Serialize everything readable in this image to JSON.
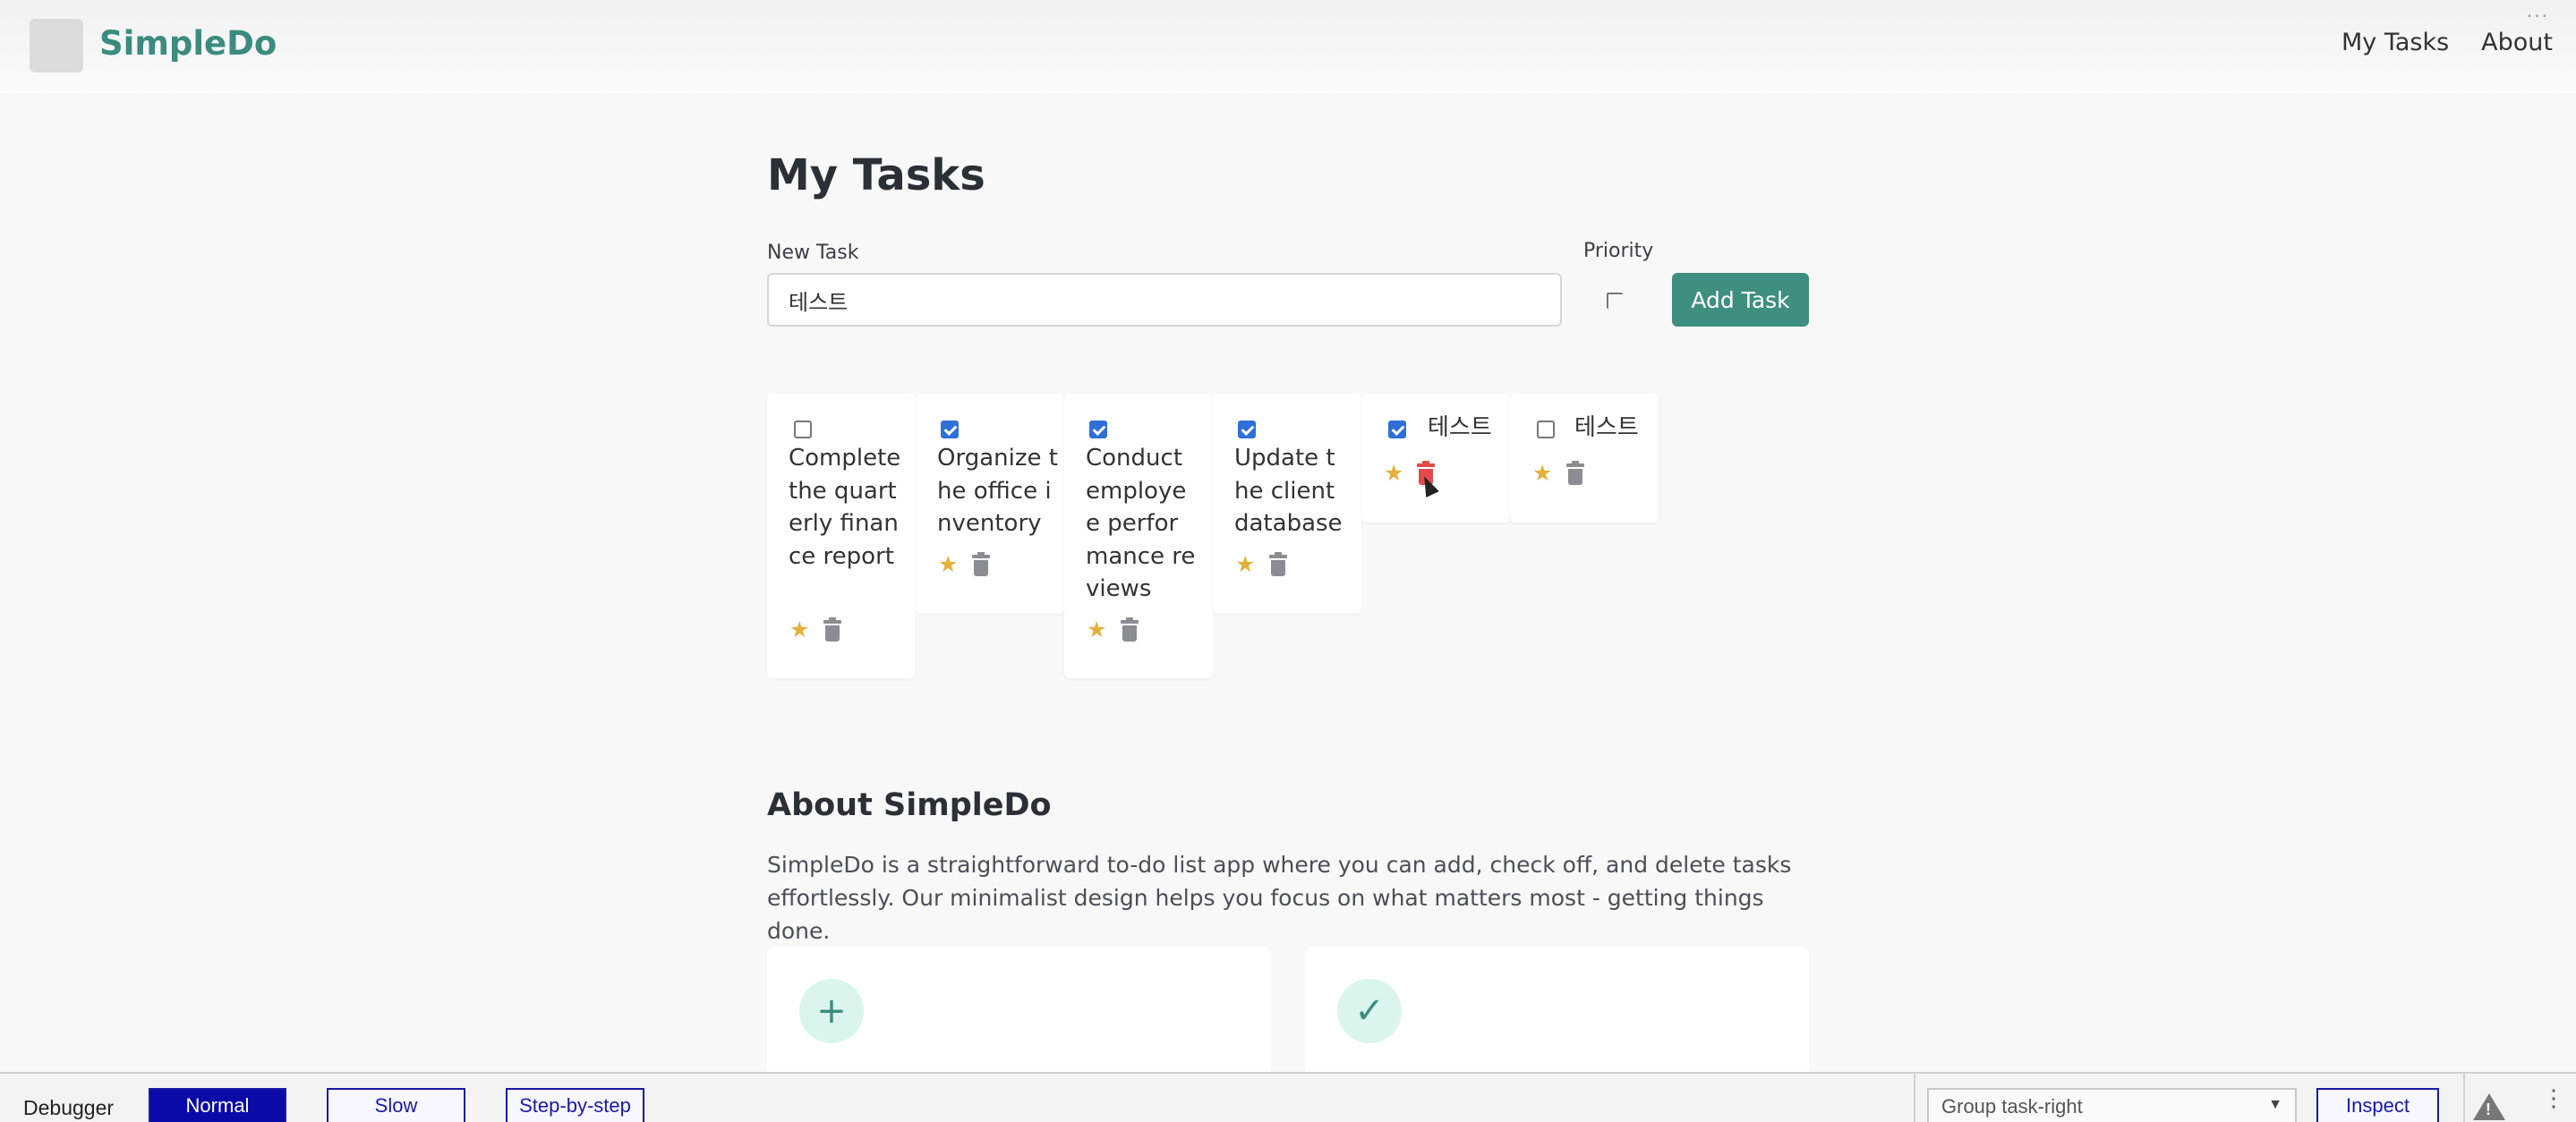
{
  "header": {
    "brand": "SimpleDo",
    "nav": [
      "My Tasks",
      "About"
    ]
  },
  "main": {
    "title": "My Tasks",
    "new_task_label": "New Task",
    "new_task_value": "테스트",
    "priority_label": "Priority",
    "priority_checked": false,
    "add_button": "Add Task",
    "tasks": [
      {
        "text": "Complete the quarterly finance report",
        "done": false
      },
      {
        "text": "Organize the office inventory",
        "done": true
      },
      {
        "text": "Conduct employee performance reviews",
        "done": true
      },
      {
        "text": "Update the client database",
        "done": true
      },
      {
        "text": "테스트",
        "done": true
      },
      {
        "text": "테스트",
        "done": false
      }
    ]
  },
  "about": {
    "title": "About SimpleDo",
    "text": "SimpleDo is a straightforward to-do list app where you can add, check off, and delete tasks effortlessly. Our minimalist design helps you focus on what matters most - getting things done.",
    "features": [
      {
        "icon": "plus-icon"
      },
      {
        "icon": "check-icon"
      }
    ]
  },
  "debugger": {
    "label": "Debugger",
    "modes": [
      "Normal",
      "Slow",
      "Step-by-step"
    ],
    "active_mode": "Normal",
    "group_select": "Group task-right",
    "inspect": "Inspect"
  },
  "colors": {
    "brand": "#3b8c7f",
    "accent_button": "#3f8f80",
    "checkbox_checked": "#2f6fd8",
    "star": "#e3b13a",
    "trash_hover": "#e24b4b",
    "debugger_active": "#0a0aa8"
  }
}
